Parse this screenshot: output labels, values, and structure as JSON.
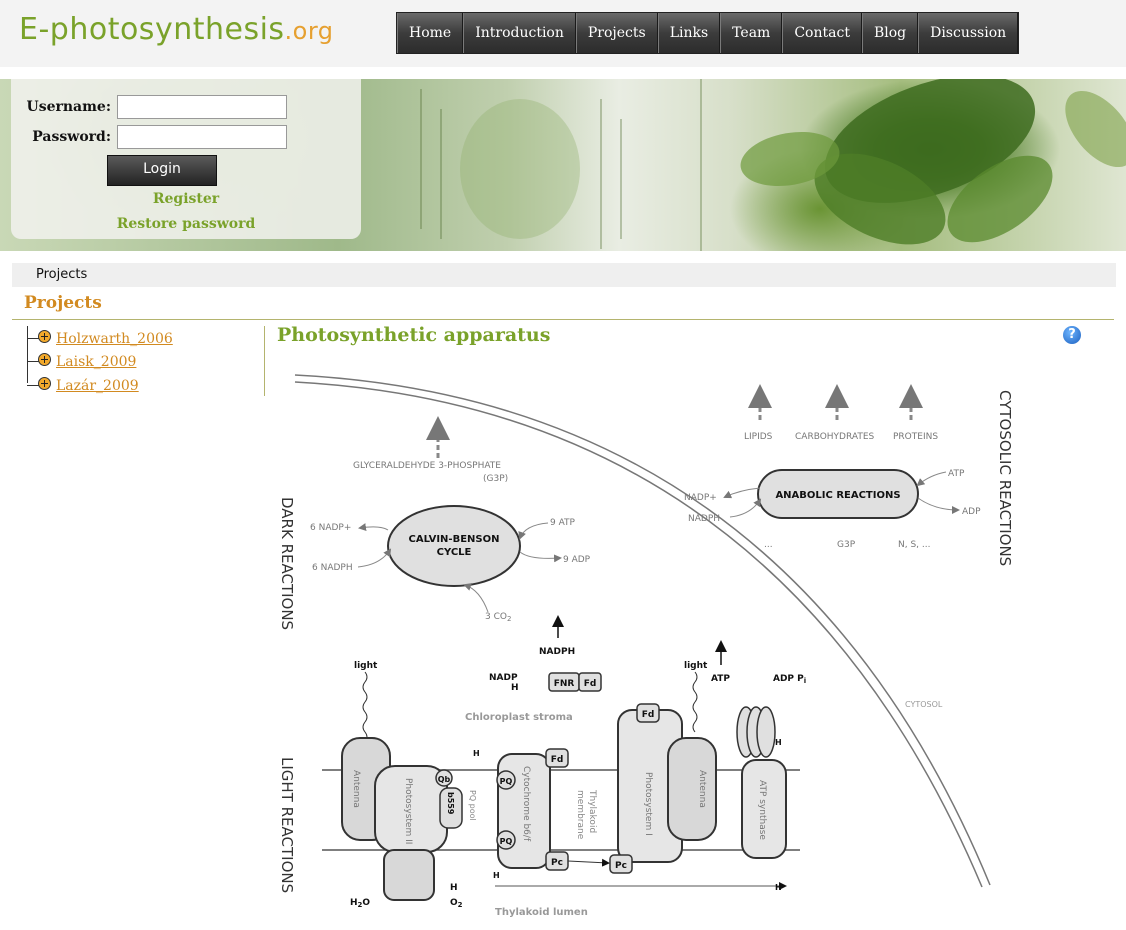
{
  "header": {
    "logo_main": "E-photosynthesis",
    "logo_tld": ".org",
    "nav": [
      "Home",
      "Introduction",
      "Projects",
      "Links",
      "Team",
      "Contact",
      "Blog",
      "Discussion"
    ]
  },
  "login": {
    "username_label": "Username:",
    "password_label": "Password:",
    "username_value": "",
    "password_value": "",
    "login_button": "Login",
    "register_link": "Register",
    "restore_link": "Restore password"
  },
  "breadcrumb": "Projects",
  "page_title": "Projects",
  "tree": [
    "Holzwarth_2006",
    "Laisk_2009",
    "Lazár_2009"
  ],
  "content": {
    "title": "Photosynthetic apparatus",
    "help_icon": "?"
  },
  "diagram": {
    "dark_reactions": "DARK REACTIONS",
    "light_reactions": "LIGHT REACTIONS",
    "cytosolic_reactions": "CYTOSOLIC REACTIONS",
    "g3p_label": "GLYCERALDEHYDE 3-PHOSPHATE",
    "g3p_abbr": "(G3P)",
    "calvin_line1": "CALVIN-BENSON",
    "calvin_line2": "CYCLE",
    "nadp6": "6 NADP+",
    "nadph6": "6 NADPH",
    "atp9": "9 ATP",
    "adp9": "9 ADP",
    "co2": "3 CO",
    "co2_sub": "2",
    "lipids": "LIPIDS",
    "carbohydrates": "CARBOHYDRATES",
    "proteins": "PROTEINS",
    "anabolic": "ANABOLIC REACTIONS",
    "nadp_plus": "NADP+",
    "nadph": "NADPH",
    "dots": "...",
    "g3p": "G3P",
    "nsdots": "N, S, ...",
    "atp": "ATP",
    "adp": "ADP",
    "cytosol": "CYTOSOL",
    "nadph_top": "NADPH",
    "nadp_h": "NADP",
    "h_plus": "H",
    "fnr": "FNR",
    "fd": "Fd",
    "stroma": "Chloroplast stroma",
    "light": "light",
    "atp_label": "ATP",
    "adp_pi": "ADP  P",
    "pi_sub": "i",
    "antenna": "Antenna",
    "photosystem2": "Photosystem II",
    "qb": "Qb",
    "b559": "b559",
    "pq_pool": "PQ pool",
    "pq": "PQ",
    "cytochrome": "Cytochrome b6/f",
    "pc": "Pc",
    "thylakoid_membrane_1": "Thylakoid",
    "thylakoid_membrane_2": "membrane",
    "photosystem1": "Photosystem I",
    "atp_synthase": "ATP synthase",
    "h2o": "H",
    "h2o_sub": "2",
    "h2o_tail": "O",
    "o2": "O",
    "o2_sub": "2",
    "lumen": "Thylakoid lumen"
  }
}
